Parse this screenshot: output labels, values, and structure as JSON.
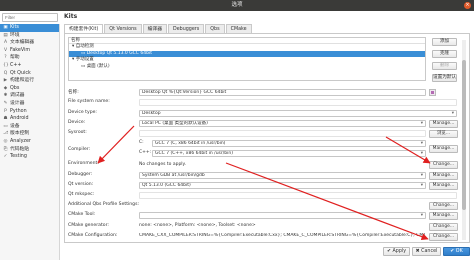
{
  "window": {
    "title": "选项",
    "close_glyph": "×"
  },
  "filter": {
    "placeholder": "Filter"
  },
  "sidebar": {
    "items": [
      {
        "label": "Kits",
        "icon": "kits-icon",
        "glyph": "▣",
        "selected": true
      },
      {
        "label": "环境",
        "icon": "environment-icon",
        "glyph": "▤"
      },
      {
        "label": "文本编辑器",
        "icon": "text-editor-icon",
        "glyph": "A"
      },
      {
        "label": "FakeVim",
        "icon": "fakevim-icon",
        "glyph": "V"
      },
      {
        "label": "帮助",
        "icon": "help-icon",
        "glyph": "?"
      },
      {
        "label": "C++",
        "icon": "cpp-icon",
        "glyph": "{}"
      },
      {
        "label": "Qt Quick",
        "icon": "qtquick-icon",
        "glyph": "Q"
      },
      {
        "label": "构建和运行",
        "icon": "build-run-icon",
        "glyph": "▶"
      },
      {
        "label": "Qbs",
        "icon": "qbs-icon",
        "glyph": "◆"
      },
      {
        "label": "调试器",
        "icon": "debugger-icon",
        "glyph": "✱"
      },
      {
        "label": "设计器",
        "icon": "designer-icon",
        "glyph": "✎"
      },
      {
        "label": "Python",
        "icon": "python-icon",
        "glyph": "P"
      },
      {
        "label": "Android",
        "icon": "android-icon",
        "glyph": "☗"
      },
      {
        "label": "设备",
        "icon": "devices-icon",
        "glyph": "▭"
      },
      {
        "label": "版本控制",
        "icon": "version-control-icon",
        "glyph": "⎇"
      },
      {
        "label": "Analyzer",
        "icon": "analyzer-icon",
        "glyph": "◎"
      },
      {
        "label": "代码粘贴",
        "icon": "code-paste-icon",
        "glyph": "⎘"
      },
      {
        "label": "Testing",
        "icon": "testing-icon",
        "glyph": "✓"
      }
    ]
  },
  "page_title": "Kits",
  "tabs": [
    "构建套件(Kit)",
    "Qt Versions",
    "编译器",
    "Debuggers",
    "Qbs",
    "CMake"
  ],
  "kit_tree": {
    "header": "名称",
    "auto_group": "▾ 自动检测",
    "auto_kit": "Desktop Qt 5.13.0 GCC 64bit",
    "manual_group": "▾ 手动设置",
    "manual_kit": "桌面 (默认)"
  },
  "side_buttons": {
    "add": "添加",
    "clone": "克隆",
    "remove": "删除",
    "make_default": "设置为默认"
  },
  "form": {
    "name_label": "名称:",
    "name_value": "Desktop Qt %{Qt:Version} GCC 64bit",
    "fs_name_label": "File system name:",
    "device_type_label": "Device type:",
    "device_type_value": "Desktop",
    "device_label": "Device:",
    "device_value": "Local PC (桌面 类型的默认设备)",
    "sysroot_label": "Sysroot:",
    "compiler_label": "Compiler:",
    "compiler_c_prefix": "C:",
    "compiler_c_value": "GCC 7 (C, x86 64bit in /usr/bin)",
    "compiler_cpp_prefix": "C++:",
    "compiler_cpp_value": "GCC 7 (C++, x86 64bit in /usr/bin)",
    "environment_label": "Environment:",
    "environment_value": "No changes to apply.",
    "debugger_label": "Debugger:",
    "debugger_value": "System GDB at /usr/bin/gdb",
    "qt_version_label": "Qt version:",
    "qt_version_value": "Qt 5.13.0 (GCC 64bit)",
    "qt_mkspec_label": "Qt mkspec:",
    "qbs_label": "Additional Qbs Profile Settings:",
    "cmake_tool_label": "CMake Tool:",
    "cmake_gen_label": "CMake generator:",
    "cmake_gen_value": "none: <none>, Platform: <none>, Toolset: <none>",
    "cmake_conf_label": "CMake Configuration:",
    "cmake_conf_value": "CMAKE_CXX_COMPILER:STRING=%{Compiler:Executable:Cxx}; CMAKE_C_COMPILER:STRING=%{Compiler:Executable:C}; CMAKE_PREFIX"
  },
  "browse_label": "浏览...",
  "manage_label": "Manage...",
  "change_label": "Change...",
  "footer": {
    "apply": "✔ Apply",
    "cancel": "✖ Cancel",
    "ok": "✔ OK"
  },
  "colors": {
    "selection": "#3a8ed6",
    "arrow": "#e02020",
    "titlebar": "#3a3a38"
  }
}
